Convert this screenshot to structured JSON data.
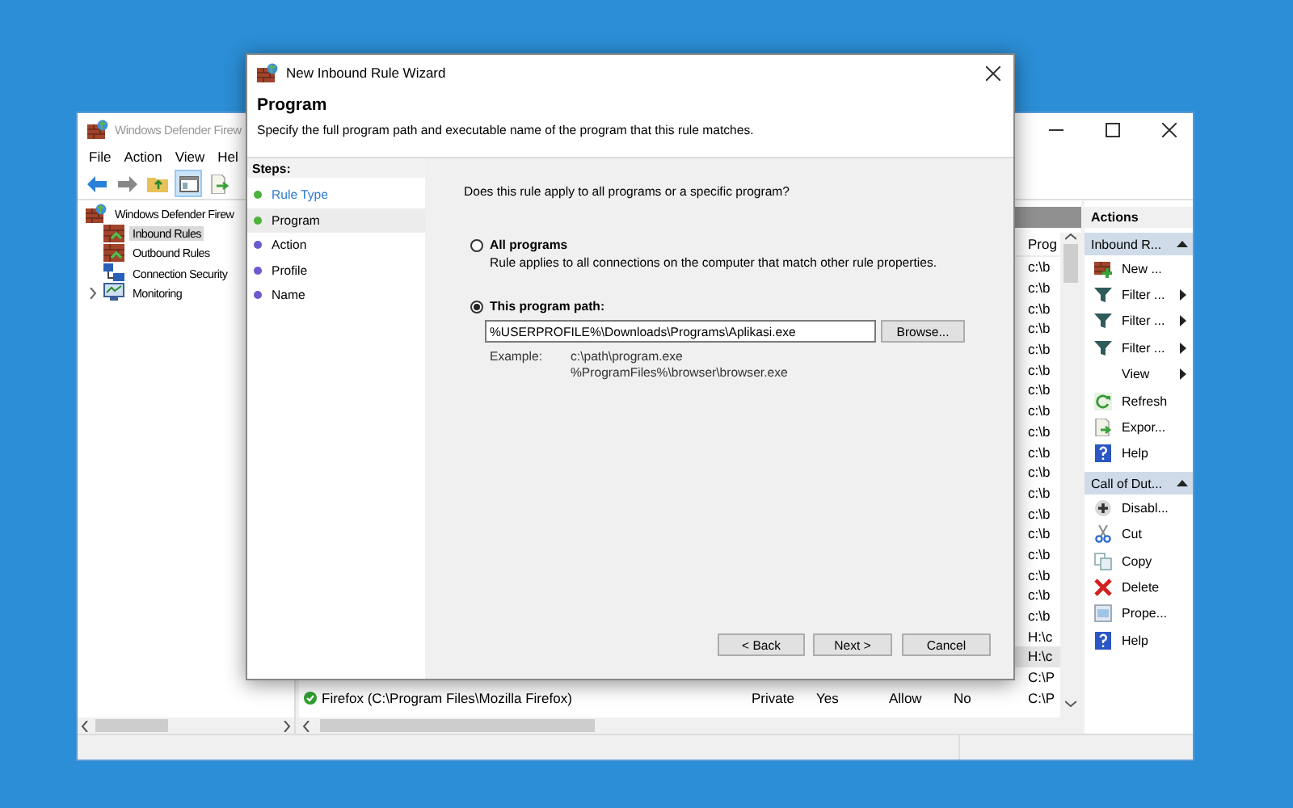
{
  "main_window": {
    "title": "Windows Defender Firew",
    "menu": [
      "File",
      "Action",
      "View",
      "Hel"
    ],
    "tree": [
      {
        "label": "Windows Defender Firew",
        "kind": "root",
        "selected": false,
        "children": [
          {
            "label": "Inbound Rules",
            "kind": "inbound",
            "selected": true
          },
          {
            "label": "Outbound Rules",
            "kind": "outbound",
            "selected": false
          },
          {
            "label": "Connection Security",
            "kind": "security",
            "selected": false
          },
          {
            "label": "Monitoring",
            "kind": "monitor",
            "selected": false,
            "expanded": false
          }
        ]
      }
    ],
    "rules": {
      "columns": [
        "Prog"
      ],
      "rows": [
        {
          "program": "c:\\b",
          "selected": false
        },
        {
          "program": "c:\\b",
          "selected": false
        },
        {
          "program": "c:\\b",
          "selected": false
        },
        {
          "program": "c:\\b",
          "selected": false
        },
        {
          "program": "c:\\b",
          "selected": false
        },
        {
          "program": "c:\\b",
          "selected": false
        },
        {
          "program": "c:\\b",
          "selected": false
        },
        {
          "program": "c:\\b",
          "selected": false
        },
        {
          "program": "c:\\b",
          "selected": false
        },
        {
          "program": "c:\\b",
          "selected": false
        },
        {
          "program": "c:\\b",
          "selected": false
        },
        {
          "program": "c:\\b",
          "selected": false
        },
        {
          "program": "c:\\b",
          "selected": false
        },
        {
          "program": "c:\\b",
          "selected": false
        },
        {
          "program": "c:\\b",
          "selected": false
        },
        {
          "program": "c:\\b",
          "selected": false
        },
        {
          "program": "c:\\b",
          "selected": false
        },
        {
          "program": "c:\\b",
          "selected": false
        },
        {
          "program": "H:\\c",
          "selected": false
        },
        {
          "program": "H:\\c",
          "selected": true
        },
        {
          "program": "C:\\P",
          "selected": false
        },
        {
          "name": "Firefox (C:\\Program Files\\Mozilla Firefox)",
          "enabled_icon": true,
          "profile": "Private",
          "enabled": "Yes",
          "action": "Allow",
          "override": "No",
          "program": "C:\\P",
          "selected": false
        }
      ]
    },
    "actions": [
      {
        "title": "Actions",
        "groups": [
          {
            "title": "Inbound R...",
            "items": [
              {
                "label": "New ...",
                "kind": "new",
                "submenu": false
              },
              {
                "label": "Filter ...",
                "kind": "filter",
                "submenu": true
              },
              {
                "label": "Filter ...",
                "kind": "filter",
                "submenu": true
              },
              {
                "label": "Filter ...",
                "kind": "filter",
                "submenu": true
              },
              {
                "label": "View",
                "kind": "none",
                "submenu": true
              },
              {
                "label": "Refresh",
                "kind": "refresh",
                "submenu": false
              },
              {
                "label": "Expor...",
                "kind": "export",
                "submenu": false
              },
              {
                "label": "Help",
                "kind": "help",
                "submenu": false
              }
            ]
          },
          {
            "title": "Call of Dut...",
            "items": [
              {
                "label": "Disabl...",
                "kind": "disable",
                "submenu": false
              },
              {
                "label": "Cut",
                "kind": "cut",
                "submenu": false
              },
              {
                "label": "Copy",
                "kind": "copy",
                "submenu": false
              },
              {
                "label": "Delete",
                "kind": "delete",
                "submenu": false
              },
              {
                "label": "Prope...",
                "kind": "properties",
                "submenu": false
              },
              {
                "label": "Help",
                "kind": "help",
                "submenu": false
              }
            ]
          }
        ]
      }
    ]
  },
  "wizard": {
    "title": "New Inbound Rule Wizard",
    "heading": "Program",
    "description": "Specify the full program path and executable name of the program that this rule matches.",
    "steps_title": "Steps:",
    "steps": [
      {
        "label": "Rule Type",
        "color": "#4cb23a",
        "link": true,
        "selected": false
      },
      {
        "label": "Program",
        "color": "#4cb23a",
        "link": false,
        "selected": true
      },
      {
        "label": "Action",
        "color": "#6a5ad0",
        "link": false,
        "selected": false
      },
      {
        "label": "Profile",
        "color": "#6a5ad0",
        "link": false,
        "selected": false
      },
      {
        "label": "Name",
        "color": "#6a5ad0",
        "link": false,
        "selected": false
      }
    ],
    "question": "Does this rule apply to all programs or a specific program?",
    "options": [
      {
        "label": "All programs",
        "description": "Rule applies to all connections on the computer that match other rule properties.",
        "selected": false
      },
      {
        "label": "This program path:",
        "value": "%USERPROFILE%\\Downloads\\Programs\\Aplikasi.exe",
        "button": "Browse...",
        "selected": true
      }
    ],
    "example_label": "Example:",
    "examples": [
      "c:\\path\\program.exe",
      "%ProgramFiles%\\browser\\browser.exe"
    ],
    "buttons": [
      "< Back",
      "Next >",
      "Cancel"
    ]
  }
}
